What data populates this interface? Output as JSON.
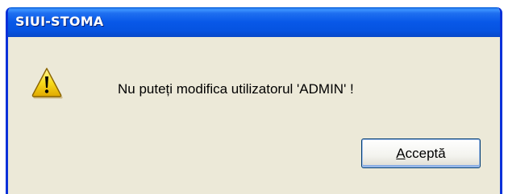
{
  "window": {
    "title": "SIUI-STOMA"
  },
  "dialog": {
    "icon": "warning-icon",
    "message": "Nu puteți modifica utilizatorul 'ADMIN' !",
    "ok_button": {
      "accel": "A",
      "rest": "cceptă"
    }
  },
  "colors": {
    "titlebar": "#0858e8",
    "frame": "#0831d9",
    "face": "#ece9d8",
    "warning": "#f5d200"
  }
}
